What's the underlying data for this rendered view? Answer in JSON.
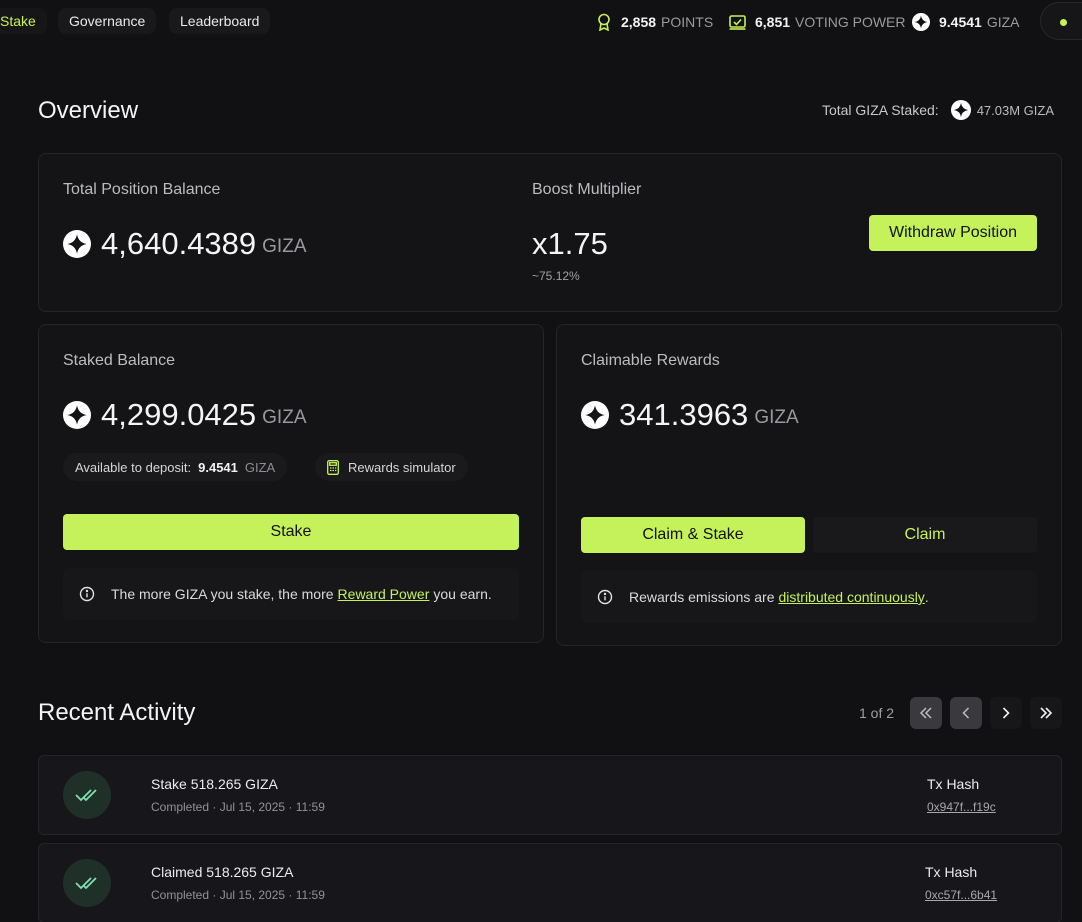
{
  "nav": {
    "tabs": [
      {
        "label": "Stake",
        "active": true
      },
      {
        "label": "Governance",
        "active": false
      },
      {
        "label": "Leaderboard",
        "active": false
      }
    ],
    "stats": {
      "points_value": "2,858",
      "points_label": "POINTS",
      "voting_value": "6,851",
      "voting_label": "VOTING POWER",
      "giza_value": "9.4541",
      "giza_label": "GIZA"
    }
  },
  "overview": {
    "title": "Overview",
    "total_staked_label": "Total GIZA Staked:",
    "total_staked_value": "47.03M GIZA"
  },
  "position": {
    "balance_label": "Total Position Balance",
    "balance_value": "4,640.4389",
    "unit": "GIZA",
    "boost_label": "Boost Multiplier",
    "boost_value": "x1.75",
    "boost_sub": "~75.12%",
    "withdraw_label": "Withdraw Position"
  },
  "staked": {
    "label": "Staked Balance",
    "value": "4,299.0425",
    "unit": "GIZA",
    "available_label": "Available to deposit:",
    "available_value": "9.4541",
    "available_unit": "GIZA",
    "simulator_label": "Rewards simulator",
    "stake_button": "Stake",
    "info_prefix": "The more GIZA you stake, the more",
    "info_link": "Reward Power",
    "info_suffix": "you earn."
  },
  "rewards": {
    "label": "Claimable Rewards",
    "value": "341.3963",
    "unit": "GIZA",
    "claim_stake_button": "Claim & Stake",
    "claim_button": "Claim",
    "info_prefix": "Rewards emissions are",
    "info_link": "distributed continuously",
    "info_suffix": "."
  },
  "activity": {
    "title": "Recent Activity",
    "page_text": "1 of 2",
    "items": [
      {
        "title": "Stake 518.265 GIZA",
        "sub": "Completed · Jul 15, 2025 · 11:59",
        "hash_label": "Tx Hash",
        "hash": "0x947f...f19c"
      },
      {
        "title": "Claimed 518.265 GIZA",
        "sub": "Completed · Jul 15, 2025 · 11:59",
        "hash_label": "Tx Hash",
        "hash": "0xc57f...6b41"
      }
    ]
  },
  "colors": {
    "accent": "#c5f25a",
    "background": "#111012",
    "card": "#141316"
  },
  "icons": [
    "award-icon",
    "voting-icon",
    "giza-token-icon",
    "info-icon",
    "calculator-icon",
    "double-check-icon",
    "first-page-icon",
    "prev-page-icon",
    "next-page-icon",
    "last-page-icon"
  ]
}
